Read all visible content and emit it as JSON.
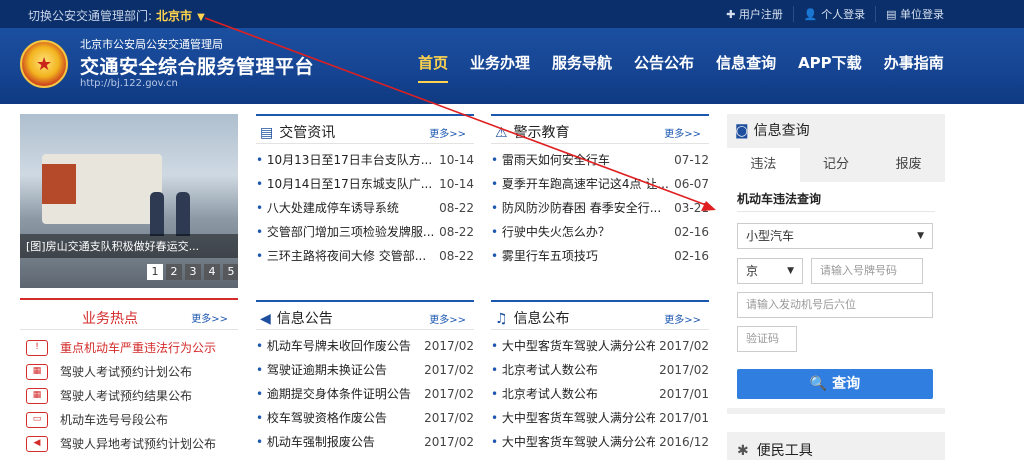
{
  "topbar": {
    "switch_label": "切换公安交通管理部门:",
    "city": "北京市",
    "links": [
      "✚ 用户注册",
      "👤 个人登录",
      "▤ 单位登录"
    ]
  },
  "header": {
    "org": "北京市公安局公安交通管理局",
    "platform": "交通安全综合服务管理平台",
    "url": "http://bj.122.gov.cn",
    "nav": [
      "首页",
      "业务办理",
      "服务导航",
      "公告公布",
      "信息查询",
      "APP下载",
      "办事指南"
    ],
    "nav_active": "首页"
  },
  "slider": {
    "caption": "[图]房山交通支队积极做好春运交...",
    "pages": [
      "1",
      "2",
      "3",
      "4",
      "5"
    ]
  },
  "news": {
    "title": "交管资讯",
    "more": "更多>>",
    "items": [
      {
        "title": "10月13日至17日丰台支队方...",
        "date": "10-14"
      },
      {
        "title": "10月14日至17日东城支队广...",
        "date": "10-14"
      },
      {
        "title": "八大处建成停车诱导系统",
        "date": "08-22"
      },
      {
        "title": "交管部门增加三项检验发牌服...",
        "date": "08-22"
      },
      {
        "title": "三环主路将夜间大修 交管部...",
        "date": "08-22"
      }
    ]
  },
  "warning": {
    "title": "警示教育",
    "more": "更多>>",
    "items": [
      {
        "title": "雷雨天如何安全行车",
        "date": "07-12"
      },
      {
        "title": "夏季开车跑高速牢记这4点 让...",
        "date": "06-07"
      },
      {
        "title": "防风防沙防春困 春季安全行...",
        "date": "03-21"
      },
      {
        "title": "行驶中失火怎么办？",
        "date": "02-16"
      },
      {
        "title": "雾里行车五项技巧",
        "date": "02-16"
      }
    ]
  },
  "notice": {
    "title": "信息公告",
    "more": "更多>>",
    "items": [
      {
        "title": "机动车号牌未收回作废公告",
        "date": "2017/02"
      },
      {
        "title": "驾驶证逾期未换证公告",
        "date": "2017/02"
      },
      {
        "title": "逾期提交身体条件证明公告",
        "date": "2017/02"
      },
      {
        "title": "校车驾驶资格作废公告",
        "date": "2017/02"
      },
      {
        "title": "机动车强制报废公告",
        "date": "2017/02"
      }
    ]
  },
  "publish": {
    "title": "信息公布",
    "more": "更多>>",
    "items": [
      {
        "title": "大中型客货车驾驶人满分公布",
        "date": "2017/02"
      },
      {
        "title": "北京考试人数公布",
        "date": "2017/02"
      },
      {
        "title": "北京考试人数公布",
        "date": "2017/01"
      },
      {
        "title": "大中型客货车驾驶人满分公布",
        "date": "2017/01"
      },
      {
        "title": "大中型客货车驾驶人满分公布",
        "date": "2016/12"
      }
    ]
  },
  "hot": {
    "title": "业务热点",
    "more": "更多>>",
    "items": [
      {
        "label": "重点机动车严重违法行为公示",
        "icon": "warning-car-icon"
      },
      {
        "label": "驾驶人考试预约计划公布",
        "icon": "calendar-icon"
      },
      {
        "label": "驾驶人考试预约结果公布",
        "icon": "calendar-icon"
      },
      {
        "label": "机动车选号号段公布",
        "icon": "plate-icon"
      },
      {
        "label": "驾驶人异地考试预约计划公布",
        "icon": "megaphone-icon"
      }
    ]
  },
  "query": {
    "title": "信息查询",
    "tabs": [
      "违法",
      "记分",
      "报废"
    ],
    "active_tab": "违法",
    "subtitle": "机动车违法查询",
    "vehicle_type": "小型汽车",
    "province": "京",
    "plate_placeholder": "请输入号牌号码",
    "engine_placeholder": "请输入发动机号后六位",
    "captcha_placeholder": "验证码",
    "button": "查询"
  },
  "tools": {
    "title": "便民工具"
  },
  "colors": {
    "header_blue": "#164593",
    "topbar": "#0a2f6b",
    "accent_gold": "#ffd34d",
    "hot_red": "#d42b2b",
    "button_blue": "#2f7ee0"
  }
}
